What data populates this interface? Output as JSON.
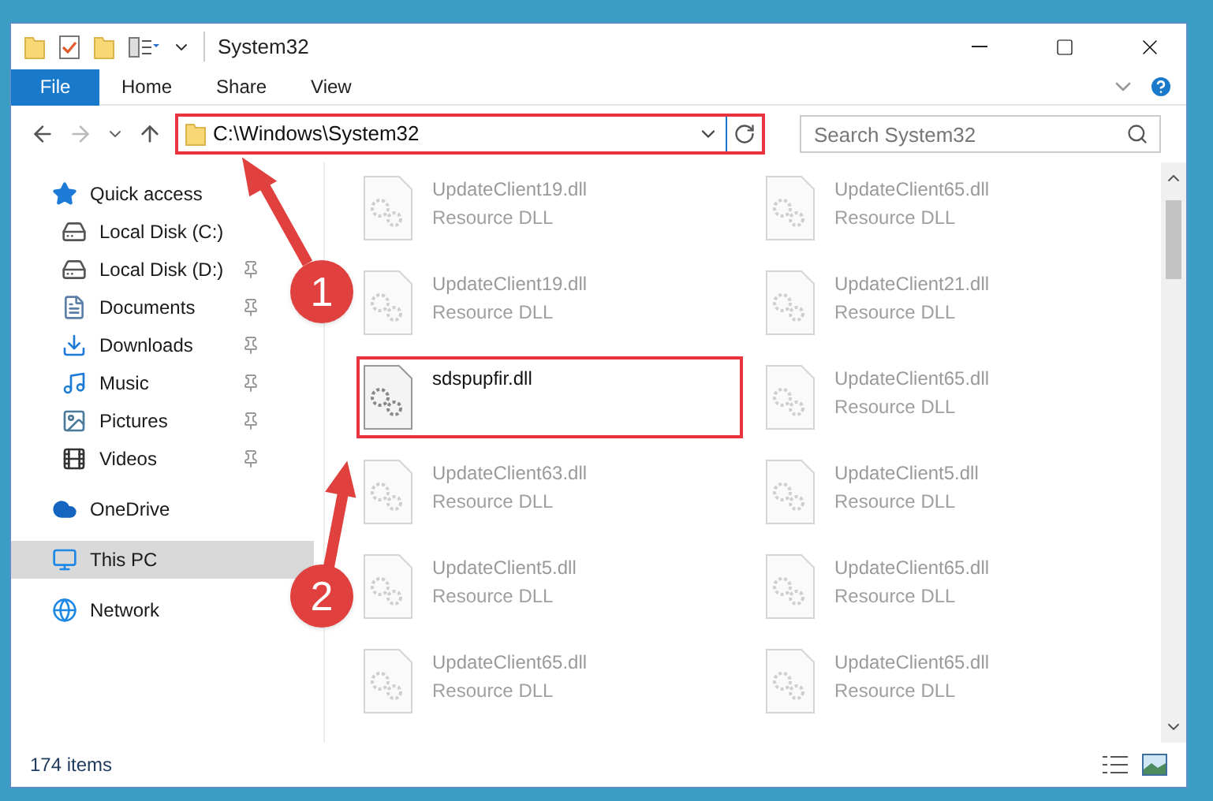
{
  "window": {
    "title": "System32"
  },
  "ribbon": {
    "file_tab": "File",
    "tabs": [
      "Home",
      "Share",
      "View"
    ]
  },
  "address": {
    "path": "C:\\Windows\\System32",
    "search_placeholder": "Search System32"
  },
  "sidebar": {
    "groups": [
      {
        "label": "Quick access",
        "kind": "star",
        "selected": false,
        "children": [
          {
            "label": "Local Disk (C:)",
            "kind": "disk-c",
            "pinned": false,
            "selected": false
          },
          {
            "label": "Local Disk (D:)",
            "kind": "disk",
            "pinned": true,
            "selected": false
          },
          {
            "label": "Documents",
            "kind": "documents",
            "pinned": true,
            "selected": false
          },
          {
            "label": "Downloads",
            "kind": "downloads",
            "pinned": true,
            "selected": false
          },
          {
            "label": "Music",
            "kind": "music",
            "pinned": true,
            "selected": false
          },
          {
            "label": "Pictures",
            "kind": "pictures",
            "pinned": true,
            "selected": false
          },
          {
            "label": "Videos",
            "kind": "videos",
            "pinned": true,
            "selected": false
          }
        ]
      },
      {
        "label": "OneDrive",
        "kind": "cloud",
        "selected": false
      },
      {
        "label": "This PC",
        "kind": "pc",
        "selected": true
      },
      {
        "label": "Network",
        "kind": "network",
        "selected": false
      }
    ]
  },
  "files": [
    {
      "name": "UpdateClient19.dll",
      "type": "Resource DLL",
      "highlighted": false
    },
    {
      "name": "UpdateClient65.dll",
      "type": "Resource DLL",
      "highlighted": false
    },
    {
      "name": "UpdateClient19.dll",
      "type": "Resource DLL",
      "highlighted": false
    },
    {
      "name": "UpdateClient21.dll",
      "type": "Resource DLL",
      "highlighted": false
    },
    {
      "name": "sdspupfir.dll",
      "highlighted": true
    },
    {
      "name": "UpdateClient65.dll",
      "type": "Resource DLL",
      "highlighted": false
    },
    {
      "name": "UpdateClient63.dll",
      "type": "Resource DLL",
      "highlighted": false
    },
    {
      "name": "UpdateClient5.dll",
      "type": "Resource DLL",
      "highlighted": false
    },
    {
      "name": "UpdateClient5.dll",
      "type": "Resource DLL",
      "highlighted": false
    },
    {
      "name": "UpdateClient65.dll",
      "type": "Resource DLL",
      "highlighted": false
    },
    {
      "name": "UpdateClient65.dll",
      "type": "Resource DLL",
      "highlighted": false
    },
    {
      "name": "UpdateClient65.dll",
      "type": "Resource DLL",
      "highlighted": false
    }
  ],
  "annotations": [
    "1",
    "2"
  ],
  "status_bar": {
    "count": "174 items"
  }
}
